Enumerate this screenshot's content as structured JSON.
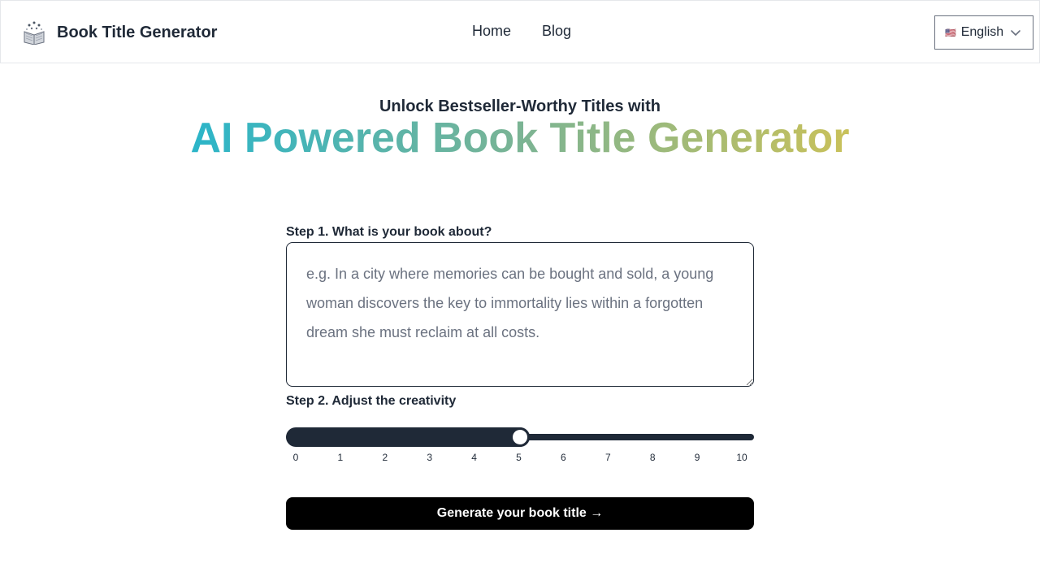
{
  "header": {
    "brand_name": "Book Title Generator",
    "brand_icon": "open-book-icon",
    "nav": [
      {
        "label": "Home"
      },
      {
        "label": "Blog"
      }
    ],
    "language": {
      "flag": "🇺🇸",
      "selected": "English"
    }
  },
  "hero": {
    "subtitle": "Unlock Bestseller-Worthy Titles with",
    "title": "AI Powered Book Title Generator"
  },
  "step1": {
    "label": "Step 1. What is your book about?",
    "value": "",
    "placeholder": "e.g. In a city where memories can be bought and sold, a young woman discovers the key to immortality lies within a forgotten dream she must reclaim at all costs."
  },
  "step2": {
    "label": "Step 2. Adjust the creativity",
    "min": 0,
    "max": 10,
    "value": 5,
    "ticks": [
      "0",
      "1",
      "2",
      "3",
      "4",
      "5",
      "6",
      "7",
      "8",
      "9",
      "10"
    ]
  },
  "generate_label": "Generate your book title →",
  "colors": {
    "primary": "#1f2937",
    "button": "#000000",
    "gradient_start": "#2bb5c9",
    "gradient_mid": "#7bb494",
    "gradient_end": "#c9c15a"
  }
}
